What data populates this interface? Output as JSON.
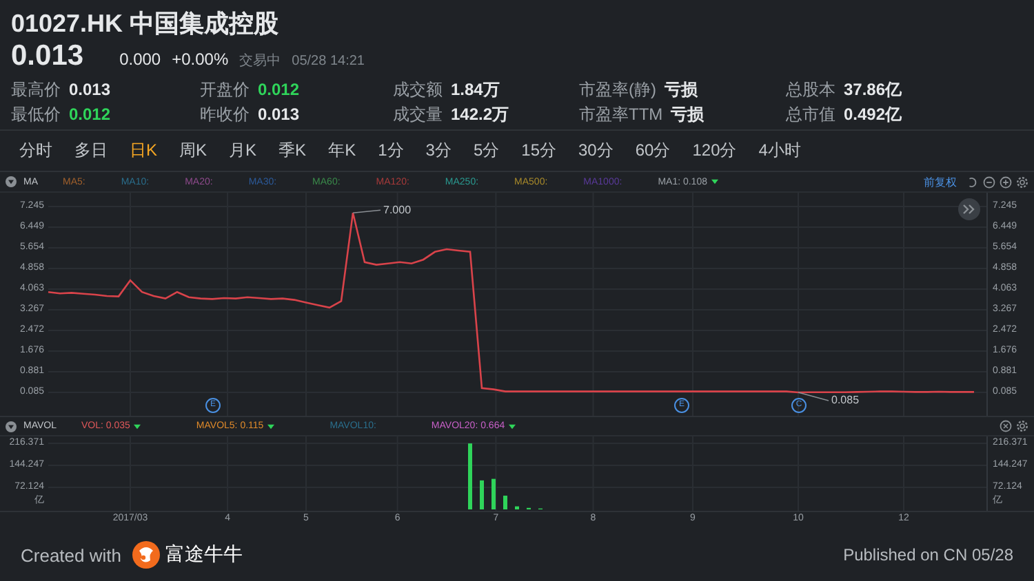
{
  "header": {
    "title": "01027.HK 中国集成控股",
    "price": "0.013",
    "change": "0.000",
    "change_pct": "+0.00%",
    "status": "交易中",
    "time": "05/28 14:21"
  },
  "stats": [
    {
      "label": "最高价",
      "value": "0.013",
      "color": "#e6e8ea"
    },
    {
      "label": "开盘价",
      "value": "0.012",
      "color": "#2fd45a"
    },
    {
      "label": "成交额",
      "value": "1.84万",
      "color": "#e6e8ea"
    },
    {
      "label": "市盈率(静)",
      "value": "亏损",
      "color": "#e6e8ea"
    },
    {
      "label": "总股本",
      "value": "37.86亿",
      "color": "#e6e8ea"
    },
    {
      "label": "最低价",
      "value": "0.012",
      "color": "#2fd45a"
    },
    {
      "label": "昨收价",
      "value": "0.013",
      "color": "#e6e8ea"
    },
    {
      "label": "成交量",
      "value": "142.2万",
      "color": "#e6e8ea"
    },
    {
      "label": "市盈率TTM",
      "value": "亏损",
      "color": "#e6e8ea"
    },
    {
      "label": "总市值",
      "value": "0.492亿",
      "color": "#e6e8ea"
    }
  ],
  "period_tabs": [
    {
      "label": "分时",
      "selected": false
    },
    {
      "label": "多日",
      "selected": false
    },
    {
      "label": "日K",
      "selected": true
    },
    {
      "label": "周K",
      "selected": false
    },
    {
      "label": "月K",
      "selected": false
    },
    {
      "label": "季K",
      "selected": false
    },
    {
      "label": "年K",
      "selected": false
    },
    {
      "label": "1分",
      "selected": false
    },
    {
      "label": "3分",
      "selected": false
    },
    {
      "label": "5分",
      "selected": false
    },
    {
      "label": "15分",
      "selected": false
    },
    {
      "label": "30分",
      "selected": false
    },
    {
      "label": "60分",
      "selected": false
    },
    {
      "label": "120分",
      "selected": false
    },
    {
      "label": "4小时",
      "selected": false
    }
  ],
  "price_panel": {
    "indicator": "MA",
    "adjust_link": "前复权",
    "legend": [
      {
        "label": "MA5:",
        "color": "#a0602c",
        "dropdown": false
      },
      {
        "label": "MA10:",
        "color": "#2a6e8c",
        "dropdown": false
      },
      {
        "label": "MA20:",
        "color": "#8e4a8c",
        "dropdown": false
      },
      {
        "label": "MA30:",
        "color": "#2c5a9a",
        "dropdown": false
      },
      {
        "label": "MA60:",
        "color": "#3a8a4a",
        "dropdown": false
      },
      {
        "label": "MA120:",
        "color": "#a83a3a",
        "dropdown": false
      },
      {
        "label": "MA250:",
        "color": "#2a9a90",
        "dropdown": false
      },
      {
        "label": "MA500:",
        "color": "#a88a2a",
        "dropdown": false
      },
      {
        "label": "MA1000:",
        "color": "#5a3a9a",
        "dropdown": false
      },
      {
        "label": "MA1: 0.108",
        "color": "#9aa0a6",
        "dropdown": true
      }
    ],
    "chart_data": {
      "type": "line",
      "color": "#d9434a",
      "values": [
        3.95,
        3.9,
        3.92,
        3.88,
        3.85,
        3.8,
        3.78,
        4.4,
        3.95,
        3.8,
        3.7,
        3.95,
        3.75,
        3.7,
        3.68,
        3.72,
        3.7,
        3.75,
        3.72,
        3.68,
        3.7,
        3.65,
        3.55,
        3.45,
        3.35,
        3.6,
        7.0,
        5.1,
        5.0,
        5.05,
        5.1,
        5.05,
        5.2,
        5.5,
        5.6,
        5.55,
        5.5,
        0.25,
        0.2,
        0.12,
        0.12,
        0.12,
        0.12,
        0.12,
        0.12,
        0.12,
        0.12,
        0.12,
        0.12,
        0.12,
        0.12,
        0.12,
        0.12,
        0.12,
        0.12,
        0.12,
        0.12,
        0.12,
        0.12,
        0.12,
        0.12,
        0.12,
        0.12,
        0.12,
        0.085,
        0.09,
        0.09,
        0.09,
        0.09,
        0.1,
        0.11,
        0.12,
        0.12,
        0.11,
        0.1,
        0.1,
        0.11,
        0.1,
        0.1,
        0.1
      ],
      "ylim": [
        0.085,
        7.245
      ],
      "yticks": [
        7.245,
        6.449,
        5.654,
        4.858,
        4.063,
        3.267,
        2.472,
        1.676,
        0.881,
        0.085
      ],
      "grid": true,
      "annotations": [
        {
          "text": "7.000"
        },
        {
          "text": "0.085"
        }
      ]
    },
    "right_axis_labels": [
      "7.245",
      "6.449",
      "5.654",
      "4.858",
      "4.063",
      "3.267",
      "2.472",
      "1.676",
      "0.881",
      "0.085"
    ],
    "event_markers": [
      {
        "label": "E"
      },
      {
        "label": "E"
      },
      {
        "label": "C"
      }
    ]
  },
  "volume_panel": {
    "indicator": "MAVOL",
    "legend": [
      {
        "label": "VOL: 0.035",
        "color": "#e0585a",
        "dropdown": true
      },
      {
        "label": "MAVOL5: 0.115",
        "color": "#e08a2a",
        "dropdown": true
      },
      {
        "label": "MAVOL10:",
        "color": "#2a6e8c",
        "dropdown": false
      },
      {
        "label": "MAVOL20: 0.664",
        "color": "#c860c8",
        "dropdown": true
      }
    ],
    "chart_data": {
      "type": "bar",
      "color": "#2fd45a",
      "values": [
        0,
        0,
        0,
        0,
        0,
        0,
        0,
        0,
        0,
        0,
        0,
        0,
        0,
        0,
        0,
        0,
        0,
        0,
        0,
        0,
        0,
        0,
        0,
        0,
        0,
        0,
        0,
        0,
        0,
        0,
        0,
        0,
        0,
        0,
        0,
        0,
        216,
        95,
        100,
        45,
        10,
        5,
        3,
        0,
        0,
        0,
        0,
        0,
        0,
        0,
        0,
        0,
        0,
        0,
        0,
        0,
        0,
        0,
        0,
        0,
        0,
        0,
        0,
        0,
        0,
        0,
        0,
        0,
        0,
        0,
        0,
        0,
        0,
        0,
        0,
        0,
        0,
        0,
        0,
        0
      ],
      "ylim": [
        0,
        216.371
      ],
      "yticks": [
        {
          "value": 216.371,
          "label": "216.371"
        },
        {
          "value": 144.247,
          "label": "144.247"
        },
        {
          "value": 72.124,
          "label": "72.124"
        }
      ],
      "grid": true
    },
    "right_axis_labels": [
      "216.371",
      "144.247",
      "72.124"
    ],
    "x_axis_labels": [
      "2017/03",
      "4",
      "5",
      "6",
      "7",
      "8",
      "9",
      "10",
      "12"
    ],
    "unit_labels": [
      "亿",
      "亿"
    ]
  },
  "footer": {
    "created_label": "Created with",
    "brand": "富途牛牛",
    "published": "Published on CN 05/28"
  }
}
